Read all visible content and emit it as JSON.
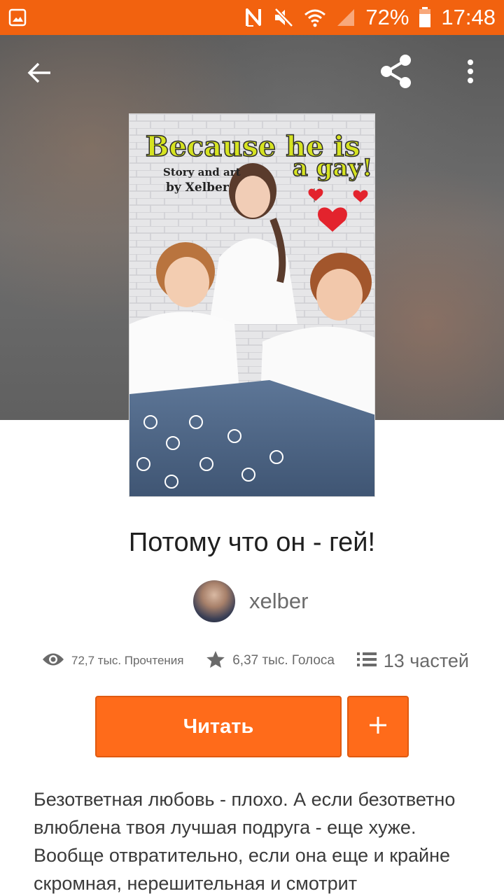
{
  "status_bar": {
    "battery": "72%",
    "time": "17:48",
    "icons": [
      "image-notification-icon",
      "nfc-icon",
      "mute-icon",
      "wifi-icon",
      "signal-icon",
      "battery-icon"
    ],
    "background": "#f2620f"
  },
  "toolbar": {
    "icons": [
      "back-arrow-icon",
      "share-icon",
      "more-vert-icon"
    ]
  },
  "cover": {
    "line1": "Because he is",
    "line2": "a gay!",
    "credit_line1": "Story and art",
    "credit_line2": "by Xelber"
  },
  "story": {
    "title": "Потому что он - гей!",
    "author": "xelber"
  },
  "stats": {
    "reads": "72,7 тыс. Прочтения",
    "votes": "6,37 тыс. Голоса",
    "parts": "13 частей"
  },
  "actions": {
    "read_label": "Читать",
    "add_label": "+"
  },
  "description": "Безответная любовь - плохо. А если безответно влюблена твоя лучшая подруга - еще хуже. Вообще отвратительно, если она еще и крайне скромная, нерешительная и смотрит",
  "colors": {
    "accent": "#ff6b1a",
    "accent_border": "#e05a10"
  }
}
